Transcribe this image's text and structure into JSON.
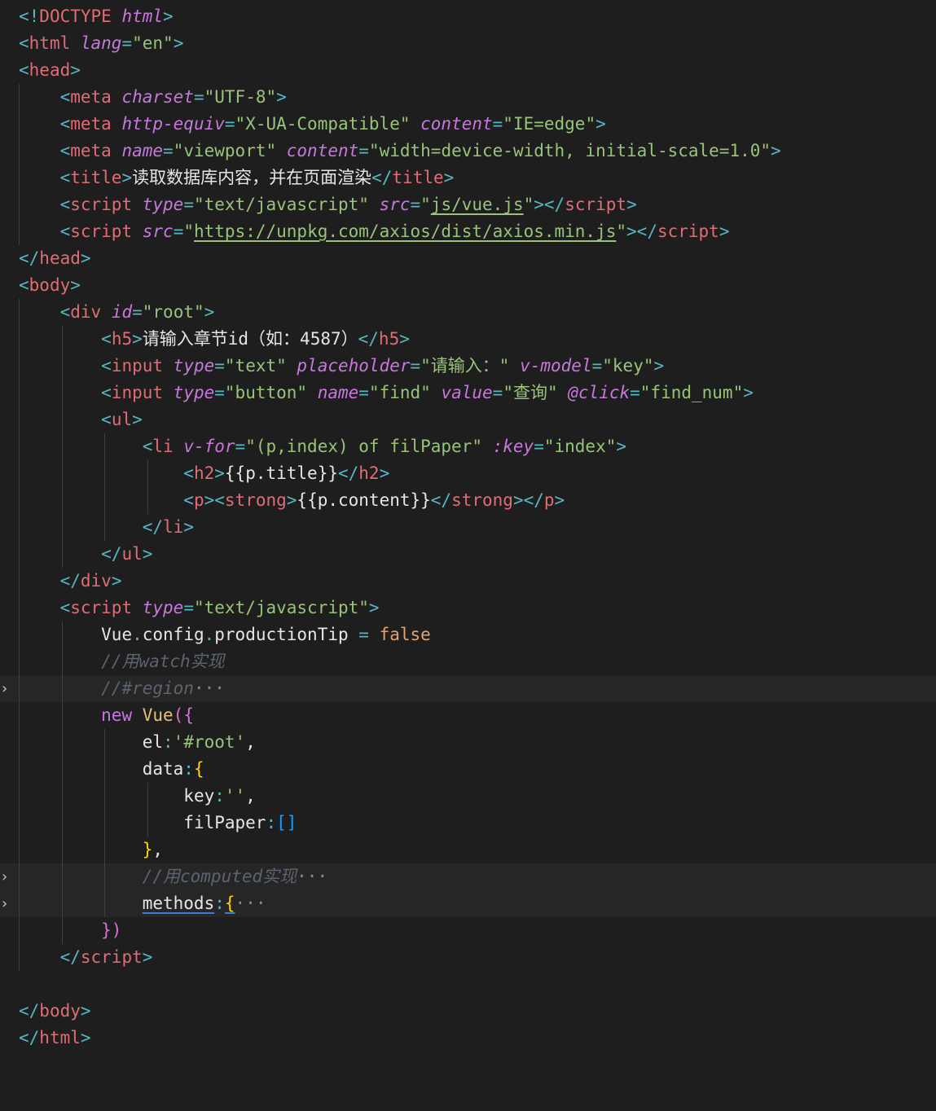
{
  "editor": {
    "lines": [
      [
        [
          "t-punc",
          "<!"
        ],
        [
          "t-tag",
          "DOCTYPE "
        ],
        [
          "t-attr",
          "html"
        ],
        [
          "t-punc",
          ">"
        ]
      ],
      [
        [
          "t-punc",
          "<"
        ],
        [
          "t-tag",
          "html "
        ],
        [
          "t-attr",
          "lang"
        ],
        [
          "t-punc",
          "="
        ],
        [
          "t-str",
          "\"en\""
        ],
        [
          "t-punc",
          ">"
        ]
      ],
      [
        [
          "t-punc",
          "<"
        ],
        [
          "t-tag",
          "head"
        ],
        [
          "t-punc",
          ">"
        ]
      ],
      [
        [
          "t-text",
          "    "
        ],
        [
          "t-punc",
          "<"
        ],
        [
          "t-tag",
          "meta "
        ],
        [
          "t-attr",
          "charset"
        ],
        [
          "t-punc",
          "="
        ],
        [
          "t-str",
          "\"UTF-8\""
        ],
        [
          "t-punc",
          ">"
        ]
      ],
      [
        [
          "t-text",
          "    "
        ],
        [
          "t-punc",
          "<"
        ],
        [
          "t-tag",
          "meta "
        ],
        [
          "t-attr",
          "http-equiv"
        ],
        [
          "t-punc",
          "="
        ],
        [
          "t-str",
          "\"X-UA-Compatible\" "
        ],
        [
          "t-attr",
          "content"
        ],
        [
          "t-punc",
          "="
        ],
        [
          "t-str",
          "\"IE=edge\""
        ],
        [
          "t-punc",
          ">"
        ]
      ],
      [
        [
          "t-text",
          "    "
        ],
        [
          "t-punc",
          "<"
        ],
        [
          "t-tag",
          "meta "
        ],
        [
          "t-attr",
          "name"
        ],
        [
          "t-punc",
          "="
        ],
        [
          "t-str",
          "\"viewport\" "
        ],
        [
          "t-attr",
          "content"
        ],
        [
          "t-punc",
          "="
        ],
        [
          "t-str",
          "\"width=device-width, initial-scale=1.0\""
        ],
        [
          "t-punc",
          ">"
        ]
      ],
      [
        [
          "t-text",
          "    "
        ],
        [
          "t-punc",
          "<"
        ],
        [
          "t-tag",
          "title"
        ],
        [
          "t-punc",
          ">"
        ],
        [
          "t-text",
          "读取数据库内容，并在页面渲染"
        ],
        [
          "t-punc",
          "</"
        ],
        [
          "t-tag",
          "title"
        ],
        [
          "t-punc",
          ">"
        ]
      ],
      [
        [
          "t-text",
          "    "
        ],
        [
          "t-punc",
          "<"
        ],
        [
          "t-tag",
          "script "
        ],
        [
          "t-attr",
          "type"
        ],
        [
          "t-punc",
          "="
        ],
        [
          "t-str",
          "\"text/javascript\" "
        ],
        [
          "t-attr",
          "src"
        ],
        [
          "t-punc",
          "="
        ],
        [
          "t-str",
          "\""
        ],
        [
          "t-str link",
          "js/vue.js"
        ],
        [
          "t-str",
          "\""
        ],
        [
          "t-punc",
          "></"
        ],
        [
          "t-tag",
          "script"
        ],
        [
          "t-punc",
          ">"
        ]
      ],
      [
        [
          "t-text",
          "    "
        ],
        [
          "t-punc",
          "<"
        ],
        [
          "t-tag",
          "script "
        ],
        [
          "t-attr",
          "src"
        ],
        [
          "t-punc",
          "="
        ],
        [
          "t-str",
          "\""
        ],
        [
          "t-str link",
          "https://unpkg.com/axios/dist/axios.min.js"
        ],
        [
          "t-str",
          "\""
        ],
        [
          "t-punc",
          "></"
        ],
        [
          "t-tag",
          "script"
        ],
        [
          "t-punc",
          ">"
        ]
      ],
      [
        [
          "t-punc",
          "</"
        ],
        [
          "t-tag",
          "head"
        ],
        [
          "t-punc",
          ">"
        ]
      ],
      [
        [
          "t-punc",
          "<"
        ],
        [
          "t-tag",
          "body"
        ],
        [
          "t-punc",
          ">"
        ]
      ],
      [
        [
          "t-text",
          "    "
        ],
        [
          "t-punc",
          "<"
        ],
        [
          "t-tag",
          "div "
        ],
        [
          "t-attr",
          "id"
        ],
        [
          "t-punc",
          "="
        ],
        [
          "t-str",
          "\"root\""
        ],
        [
          "t-punc",
          ">"
        ]
      ],
      [
        [
          "t-text",
          "        "
        ],
        [
          "t-punc",
          "<"
        ],
        [
          "t-tag",
          "h5"
        ],
        [
          "t-punc",
          ">"
        ],
        [
          "t-text",
          "请输入章节id（如：4587）"
        ],
        [
          "t-punc",
          "</"
        ],
        [
          "t-tag",
          "h5"
        ],
        [
          "t-punc",
          ">"
        ]
      ],
      [
        [
          "t-text",
          "        "
        ],
        [
          "t-punc",
          "<"
        ],
        [
          "t-tag",
          "input "
        ],
        [
          "t-attr",
          "type"
        ],
        [
          "t-punc",
          "="
        ],
        [
          "t-str",
          "\"text\" "
        ],
        [
          "t-attr",
          "placeholder"
        ],
        [
          "t-punc",
          "="
        ],
        [
          "t-str",
          "\"请输入：\" "
        ],
        [
          "t-attr",
          "v-model"
        ],
        [
          "t-punc",
          "="
        ],
        [
          "t-str",
          "\"key\""
        ],
        [
          "t-punc",
          ">"
        ]
      ],
      [
        [
          "t-text",
          "        "
        ],
        [
          "t-punc",
          "<"
        ],
        [
          "t-tag",
          "input "
        ],
        [
          "t-attr",
          "type"
        ],
        [
          "t-punc",
          "="
        ],
        [
          "t-str",
          "\"button\" "
        ],
        [
          "t-attr",
          "name"
        ],
        [
          "t-punc",
          "="
        ],
        [
          "t-str",
          "\"find\" "
        ],
        [
          "t-attr",
          "value"
        ],
        [
          "t-punc",
          "="
        ],
        [
          "t-str",
          "\"查询\" "
        ],
        [
          "t-attr",
          "@click"
        ],
        [
          "t-punc",
          "="
        ],
        [
          "t-str",
          "\"find_num\""
        ],
        [
          "t-punc",
          ">"
        ]
      ],
      [
        [
          "t-text",
          "        "
        ],
        [
          "t-punc",
          "<"
        ],
        [
          "t-tag",
          "ul"
        ],
        [
          "t-punc",
          ">"
        ]
      ],
      [
        [
          "t-text",
          "            "
        ],
        [
          "t-punc",
          "<"
        ],
        [
          "t-tag",
          "li "
        ],
        [
          "t-attr",
          "v-for"
        ],
        [
          "t-punc",
          "="
        ],
        [
          "t-str",
          "\"(p,index) of filPaper\" "
        ],
        [
          "t-attr",
          ":key"
        ],
        [
          "t-punc",
          "="
        ],
        [
          "t-str",
          "\"index\""
        ],
        [
          "t-punc",
          ">"
        ]
      ],
      [
        [
          "t-text",
          "                "
        ],
        [
          "t-punc",
          "<"
        ],
        [
          "t-tag",
          "h2"
        ],
        [
          "t-punc",
          ">"
        ],
        [
          "t-text",
          "{{p.title}}"
        ],
        [
          "t-punc",
          "</"
        ],
        [
          "t-tag",
          "h2"
        ],
        [
          "t-punc",
          ">"
        ]
      ],
      [
        [
          "t-text",
          "                "
        ],
        [
          "t-punc",
          "<"
        ],
        [
          "t-tag",
          "p"
        ],
        [
          "t-punc",
          "><"
        ],
        [
          "t-tag",
          "strong"
        ],
        [
          "t-punc",
          ">"
        ],
        [
          "t-text",
          "{{p.content}}"
        ],
        [
          "t-punc",
          "</"
        ],
        [
          "t-tag",
          "strong"
        ],
        [
          "t-punc",
          "></"
        ],
        [
          "t-tag",
          "p"
        ],
        [
          "t-punc",
          ">"
        ]
      ],
      [
        [
          "t-text",
          "            "
        ],
        [
          "t-punc",
          "</"
        ],
        [
          "t-tag",
          "li"
        ],
        [
          "t-punc",
          ">"
        ]
      ],
      [
        [
          "t-text",
          "        "
        ],
        [
          "t-punc",
          "</"
        ],
        [
          "t-tag",
          "ul"
        ],
        [
          "t-punc",
          ">"
        ]
      ],
      [
        [
          "t-text",
          "    "
        ],
        [
          "t-punc",
          "</"
        ],
        [
          "t-tag",
          "div"
        ],
        [
          "t-punc",
          ">"
        ]
      ],
      [
        [
          "t-text",
          "    "
        ],
        [
          "t-punc",
          "<"
        ],
        [
          "t-tag",
          "script "
        ],
        [
          "t-attr",
          "type"
        ],
        [
          "t-punc",
          "="
        ],
        [
          "t-str",
          "\"text/javascript\""
        ],
        [
          "t-punc",
          ">"
        ]
      ],
      [
        [
          "t-text",
          "        "
        ],
        [
          "t-prop",
          "Vue"
        ],
        [
          "t-op",
          "."
        ],
        [
          "t-prop",
          "config"
        ],
        [
          "t-op",
          "."
        ],
        [
          "t-prop",
          "productionTip "
        ],
        [
          "t-op",
          "= "
        ],
        [
          "t-bool",
          "false"
        ]
      ],
      [
        [
          "t-text",
          "        "
        ],
        [
          "t-comment",
          "//用watch实现"
        ]
      ],
      [
        [
          "t-text",
          "        "
        ],
        [
          "t-comment",
          "//#region"
        ],
        [
          "ellipsis",
          "···"
        ]
      ],
      [
        [
          "t-text",
          "        "
        ],
        [
          "t-kw",
          "new "
        ],
        [
          "t-class",
          "Vue"
        ],
        [
          "t-br1",
          "({"
        ]
      ],
      [
        [
          "t-text",
          "            "
        ],
        [
          "t-prop",
          "el"
        ],
        [
          "t-op",
          ":"
        ],
        [
          "t-str",
          "'#root'"
        ],
        [
          "t-text",
          ","
        ]
      ],
      [
        [
          "t-text",
          "            "
        ],
        [
          "t-prop",
          "data"
        ],
        [
          "t-op",
          ":"
        ],
        [
          "t-br2",
          "{"
        ]
      ],
      [
        [
          "t-text",
          "                "
        ],
        [
          "t-prop",
          "key"
        ],
        [
          "t-op",
          ":"
        ],
        [
          "t-str",
          "''"
        ],
        [
          "t-text",
          ","
        ]
      ],
      [
        [
          "t-text",
          "                "
        ],
        [
          "t-prop",
          "filPaper"
        ],
        [
          "t-op",
          ":"
        ],
        [
          "t-br3",
          "[]"
        ]
      ],
      [
        [
          "t-text",
          "            "
        ],
        [
          "t-br2",
          "}"
        ],
        [
          "t-text",
          ","
        ]
      ],
      [
        [
          "t-text",
          "            "
        ],
        [
          "t-comment",
          "//用computed实现"
        ],
        [
          "ellipsis",
          "···"
        ]
      ],
      [
        [
          "t-text",
          "            "
        ],
        [
          "t-prop method-underline",
          "methods"
        ],
        [
          "t-op",
          ":"
        ],
        [
          "t-br2 method-underline",
          "{"
        ],
        [
          "ellipsis",
          "···"
        ]
      ],
      [
        [
          "t-text",
          "        "
        ],
        [
          "t-br1",
          "})"
        ]
      ],
      [
        [
          "t-text",
          "    "
        ],
        [
          "t-punc",
          "</"
        ],
        [
          "t-tag",
          "script"
        ],
        [
          "t-punc",
          ">"
        ]
      ],
      [],
      [
        [
          "t-punc",
          "</"
        ],
        [
          "t-tag",
          "body"
        ],
        [
          "t-punc",
          ">"
        ]
      ],
      [
        [
          "t-punc",
          "</"
        ],
        [
          "t-tag",
          "html"
        ],
        [
          "t-punc",
          ">"
        ]
      ]
    ],
    "folded_lines": [
      25,
      32,
      33
    ],
    "fold_icon": "chevron-right-icon",
    "fold_glyph": "›"
  }
}
